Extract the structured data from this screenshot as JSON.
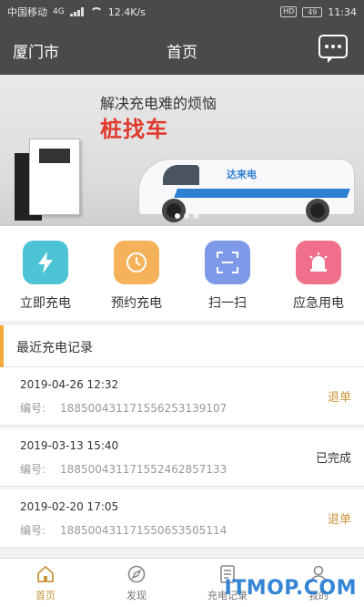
{
  "status_bar": {
    "carrier": "中国移动",
    "network": "4G",
    "speed": "12.4K/s",
    "hd": "HD",
    "battery": "49",
    "time": "11:34"
  },
  "header": {
    "city": "厦门市",
    "title": "首页",
    "message_icon": "chat-bubble-icon"
  },
  "banner": {
    "slogan": "解决充电难的烦恼",
    "brand": "桩找车",
    "van_logo": "达来电"
  },
  "quick_actions": [
    {
      "label": "立即充电",
      "icon": "lightning-icon",
      "color": "#4cc4d6"
    },
    {
      "label": "预约充电",
      "icon": "clock-icon",
      "color": "#f5b25b"
    },
    {
      "label": "扫一扫",
      "icon": "scan-icon",
      "color": "#7d99e8"
    },
    {
      "label": "应急用电",
      "icon": "siren-icon",
      "color": "#f06f8a"
    }
  ],
  "recent": {
    "title": "最近充电记录",
    "accent": "#f2a93b"
  },
  "records": [
    {
      "date": "2019-04-26 12:32",
      "number_label": "编号:",
      "number": "18850043117155625313910​7",
      "status": "退单",
      "status_color": "#c9953a"
    },
    {
      "date": "2019-03-13 15:40",
      "number_label": "编号:",
      "number": "1885004311715524628571​33",
      "status": "已完成",
      "status_color": "#333333"
    },
    {
      "date": "2019-02-20 17:05",
      "number_label": "编号:",
      "number": "1885004311715506535051​14",
      "status": "退单",
      "status_color": "#c9953a"
    }
  ],
  "tabs": [
    {
      "label": "首页",
      "icon": "home-icon",
      "active": true
    },
    {
      "label": "发现",
      "icon": "compass-icon",
      "active": false
    },
    {
      "label": "充电记录",
      "icon": "record-icon",
      "active": false
    },
    {
      "label": "我的",
      "icon": "profile-icon",
      "active": false
    }
  ],
  "watermark": "ITMOP.COM"
}
